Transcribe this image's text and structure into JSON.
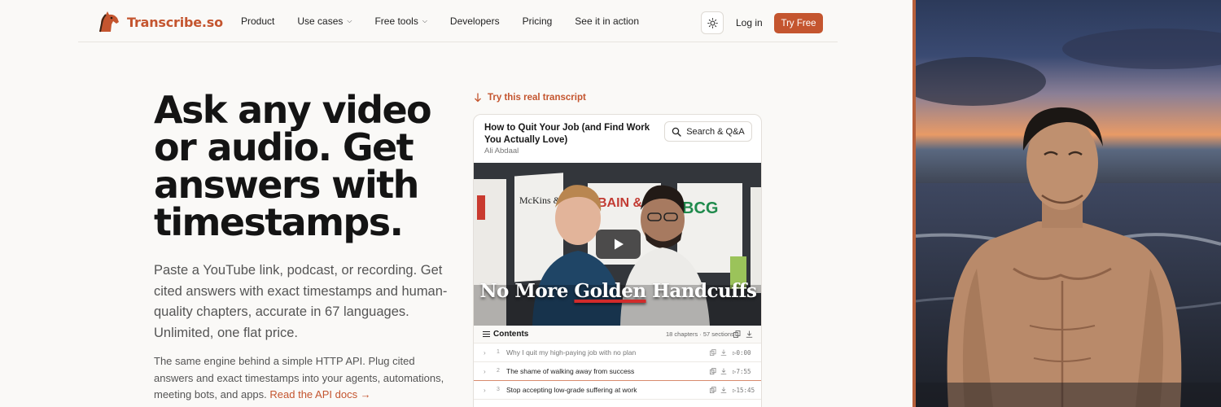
{
  "brand": {
    "name": "Transcribe.so",
    "accent": "#c4552f"
  },
  "nav": {
    "links": [
      {
        "label": "Product",
        "dropdown": false
      },
      {
        "label": "Use cases",
        "dropdown": true
      },
      {
        "label": "Free tools",
        "dropdown": true
      },
      {
        "label": "Developers",
        "dropdown": false
      },
      {
        "label": "Pricing",
        "dropdown": false
      },
      {
        "label": "See it in action",
        "dropdown": false
      }
    ],
    "theme_toggle_icon": "sun-icon",
    "login": "Log in",
    "cta": "Try Free"
  },
  "hero": {
    "title": "Ask any video or audio. Get answers with timestamps.",
    "subtitle": "Paste a YouTube link, podcast, or recording. Get cited answers with exact timestamps and human-quality chapters, accurate in 67 languages. Unlimited, one flat price.",
    "api_text": "The same engine behind a simple HTTP API. Plug cited answers and exact timestamps into your agents, automations, meeting bots, and apps.",
    "api_link": "Read the API docs →"
  },
  "demo": {
    "label": "Try this real transcript",
    "video_title": "How to Quit Your Job (and Find Work You Actually Love)",
    "author": "Ali Abdaal",
    "search_button": "Search & Q&A",
    "thumbnail": {
      "text_before": "No More ",
      "text_highlight": "Golden",
      "text_after": " Handcuffs",
      "logos": [
        "McKins & C",
        "BAIN & COMPANY",
        "BCG"
      ]
    },
    "contents": {
      "title": "Contents",
      "meta": "18 chapters · 57 sections",
      "chapters": [
        {
          "num": "1",
          "title": "Why I quit my high-paying job with no plan",
          "time": "0:00"
        },
        {
          "num": "2",
          "title": "The shame of walking away from success",
          "time": "7:55"
        },
        {
          "num": "3",
          "title": "Stop accepting low-grade suffering at work",
          "time": "15:45"
        }
      ]
    }
  }
}
